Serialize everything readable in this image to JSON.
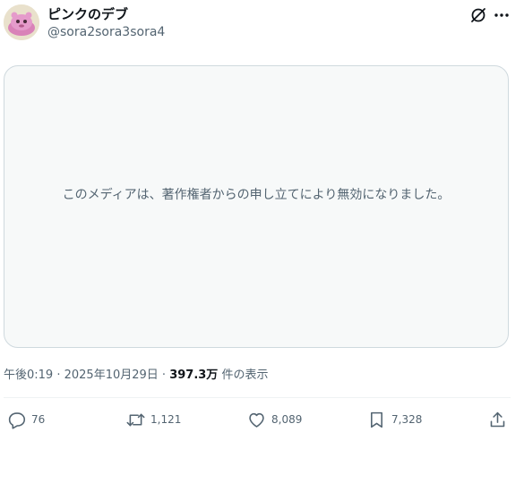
{
  "author": {
    "display_name": "ピンクのデブ",
    "handle": "@sora2sora3sora4",
    "avatar_icon": "pink-character-avatar"
  },
  "header_icons": [
    "grok-icon",
    "more-icon"
  ],
  "media": {
    "message": "このメディアは、著作権者からの申し立てにより無効になりました。"
  },
  "meta": {
    "time": "午後0:19",
    "separator1": " · ",
    "date": "2025年10月29日",
    "separator2": " · ",
    "views_count": "397.3万",
    "views_label": " 件の表示"
  },
  "actions": {
    "reply_count": "76",
    "retweet_count": "1,121",
    "like_count": "8,089",
    "bookmark_count": "7,328"
  },
  "colors": {
    "text_primary": "#0f1419",
    "text_secondary": "#536471",
    "media_bg": "#f7f9f9",
    "border": "#cfd9de"
  }
}
